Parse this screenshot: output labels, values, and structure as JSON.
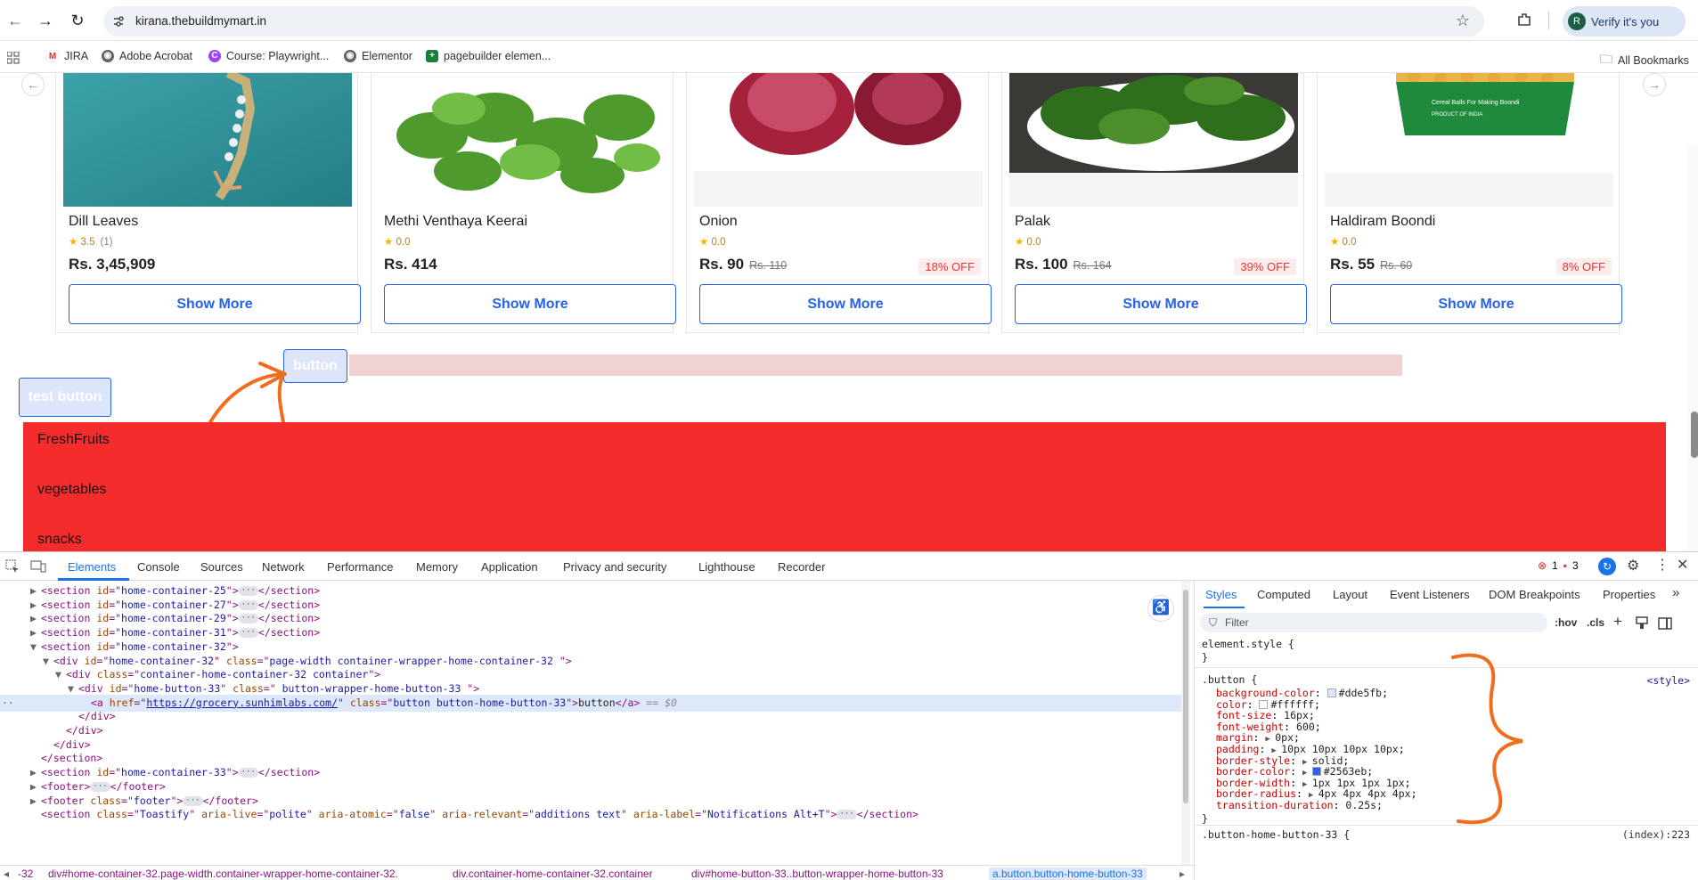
{
  "browser": {
    "url": "kirana.thebuildmymart.in",
    "verify_label": "Verify it's you",
    "profile_initial": "R",
    "bookmarks": [
      {
        "label": "JIRA",
        "icon": "gmail-icon",
        "color": "#d93025"
      },
      {
        "label": "Adobe Acrobat",
        "icon": "globe-icon",
        "color": "#5f6368"
      },
      {
        "label": "Course: Playwright...",
        "icon": "course-icon",
        "color": "#a142f4"
      },
      {
        "label": "Elementor",
        "icon": "globe-icon",
        "color": "#5f6368"
      },
      {
        "label": "pagebuilder elemen...",
        "icon": "sheets-icon",
        "color": "#188038"
      }
    ],
    "all_bookmarks": "All Bookmarks"
  },
  "products": [
    {
      "name": "Dill Leaves",
      "rating": "3.5",
      "count": "(1)",
      "price": "Rs. 3,45,909",
      "mrp": "",
      "discount": "",
      "button": "Show More",
      "image": "ring"
    },
    {
      "name": "Methi Venthaya Keerai",
      "rating": "0.0",
      "count": "",
      "price": "Rs. 414",
      "mrp": "",
      "discount": "",
      "button": "Show More",
      "image": "leaves"
    },
    {
      "name": "Onion",
      "rating": "0.0",
      "count": "",
      "price": "Rs. 90",
      "mrp": "Rs. 110",
      "discount": "18% OFF",
      "button": "Show More",
      "image": "onion"
    },
    {
      "name": "Palak",
      "rating": "0.0",
      "count": "",
      "price": "Rs. 100",
      "mrp": "Rs. 164",
      "discount": "39% OFF",
      "button": "Show More",
      "image": "spinach"
    },
    {
      "name": "Haldiram Boondi",
      "rating": "0.0",
      "count": "",
      "price": "Rs. 55",
      "mrp": "Rs. 60",
      "discount": "8% OFF",
      "button": "Show More",
      "image": "boondi"
    }
  ],
  "page": {
    "button_label": "button",
    "test_button_label": "test button",
    "categories": [
      "FreshFruits",
      "vegetables",
      "snacks"
    ]
  },
  "devtools": {
    "tabs": [
      "Elements",
      "Console",
      "Sources",
      "Network",
      "Performance",
      "Memory",
      "Application",
      "Privacy and security",
      "Lighthouse",
      "Recorder"
    ],
    "errors": "1",
    "issues": "3",
    "tree": [
      {
        "indent": 0,
        "tri": "▶",
        "tag": "section",
        "attrs": [
          [
            "id",
            "home-container-25"
          ]
        ],
        "collapsed": true
      },
      {
        "indent": 0,
        "tri": "▶",
        "tag": "section",
        "attrs": [
          [
            "id",
            "home-container-27"
          ]
        ],
        "collapsed": true
      },
      {
        "indent": 0,
        "tri": "▶",
        "tag": "section",
        "attrs": [
          [
            "id",
            "home-container-29"
          ]
        ],
        "collapsed": true
      },
      {
        "indent": 0,
        "tri": "▶",
        "tag": "section",
        "attrs": [
          [
            "id",
            "home-container-31"
          ]
        ],
        "collapsed": true
      },
      {
        "indent": 0,
        "tri": "▼",
        "tag": "section",
        "attrs": [
          [
            "id",
            "home-container-32"
          ]
        ]
      },
      {
        "indent": 1,
        "tri": "▼",
        "tag": "div",
        "attrs": [
          [
            "id",
            "home-container-32"
          ],
          [
            "class",
            "page-width container-wrapper-home-container-32 "
          ]
        ]
      },
      {
        "indent": 2,
        "tri": "▼",
        "tag": "div",
        "attrs": [
          [
            "class",
            "container-home-container-32 container"
          ]
        ]
      },
      {
        "indent": 3,
        "tri": "▼",
        "tag": "div",
        "attrs": [
          [
            "id",
            "home-button-33"
          ],
          [
            "class",
            " button-wrapper-home-button-33 "
          ]
        ]
      },
      {
        "indent": 4,
        "tri": "",
        "tag": "a",
        "attrs": [
          [
            "href",
            "https://grocery.sunhimlabs.com/"
          ],
          [
            "class",
            "button button-home-button-33"
          ]
        ],
        "text": "button",
        "selected": true
      },
      {
        "indent": 3,
        "close": "div"
      },
      {
        "indent": 2,
        "close": "div"
      },
      {
        "indent": 1,
        "close": "div"
      },
      {
        "indent": 0,
        "close": "section"
      },
      {
        "indent": 0,
        "tri": "▶",
        "tag": "section",
        "attrs": [
          [
            "id",
            "home-container-33"
          ]
        ],
        "collapsed": true
      },
      {
        "indent": 0,
        "tri": "▶",
        "tag": "footer",
        "attrs": [],
        "collapsed": true
      },
      {
        "indent": 0,
        "tri": "▶",
        "tag": "footer",
        "attrs": [
          [
            "class",
            "footer"
          ]
        ],
        "collapsed": true
      },
      {
        "indent": 0,
        "tri": "",
        "tag": "section",
        "attrs": [
          [
            "class",
            "Toastify"
          ],
          [
            "aria-live",
            "polite"
          ],
          [
            "aria-atomic",
            "false"
          ],
          [
            "aria-relevant",
            "additions text"
          ],
          [
            "aria-label",
            "Notifications Alt+T"
          ]
        ],
        "collapsed": true
      }
    ],
    "breadcrumbs": [
      "-32",
      "div#home-container-32.page-width.container-wrapper-home-container-32.",
      "div.container-home-container-32.container",
      "div#home-button-33..button-wrapper-home-button-33",
      "a.button.button-home-button-33"
    ],
    "styles_tabs": [
      "Styles",
      "Computed",
      "Layout",
      "Event Listeners",
      "DOM Breakpoints",
      "Properties"
    ],
    "filter_placeholder": "Filter",
    "hov": ":hov",
    "cls": ".cls",
    "element_style": "element.style {",
    "rule_selector": ".button {",
    "rule_source": "<style>",
    "rule_props": [
      {
        "name": "background-color",
        "value": "#dde5fb",
        "swatch": "#dde5fb"
      },
      {
        "name": "color",
        "value": "#ffffff",
        "swatch": "#ffffff"
      },
      {
        "name": "font-size",
        "value": "16px"
      },
      {
        "name": "font-weight",
        "value": "600"
      },
      {
        "name": "margin",
        "value": "0px",
        "tri": true
      },
      {
        "name": "padding",
        "value": "10px 10px 10px 10px",
        "tri": true
      },
      {
        "name": "border-style",
        "value": "solid",
        "tri": true
      },
      {
        "name": "border-color",
        "value": "#2563eb",
        "tri": true,
        "swatch": "#2563eb"
      },
      {
        "name": "border-width",
        "value": "1px 1px 1px 1px",
        "tri": true
      },
      {
        "name": "border-radius",
        "value": "4px 4px 4px 4px",
        "tri": true
      },
      {
        "name": "transition-duration",
        "value": "0.25s"
      }
    ],
    "rule2_selector": ".button-home-button-33 {",
    "rule2_source": "(index):223"
  },
  "colors": {
    "accent": "#2563eb",
    "red_section": "#f52c2c",
    "annotation": "#f26c1e"
  }
}
